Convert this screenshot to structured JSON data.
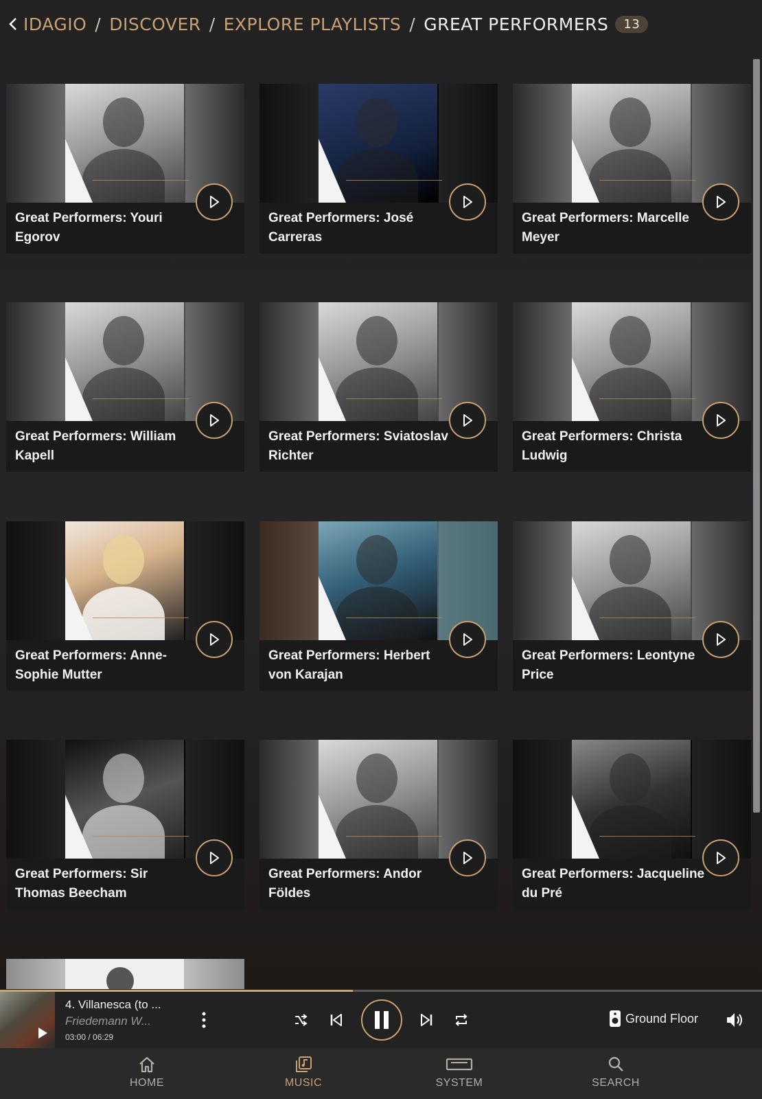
{
  "breadcrumb": {
    "items": [
      "IDAGIO",
      "DISCOVER",
      "EXPLORE PLAYLISTS"
    ],
    "current": "GREAT PERFORMERS",
    "count": "13",
    "separator": "/"
  },
  "playlists": [
    {
      "title": "Great Performers: Youri Egorov"
    },
    {
      "title": "Great Performers: José Carreras"
    },
    {
      "title": "Great Performers: Marcelle Meyer"
    },
    {
      "title": "Great Performers: William Kapell"
    },
    {
      "title": "Great Performers: Sviatoslav Richter"
    },
    {
      "title": "Great Performers: Christa Ludwig"
    },
    {
      "title": "Great Performers: Anne-Sophie Mutter"
    },
    {
      "title": "Great Performers: Herbert von Karajan"
    },
    {
      "title": "Great Performers: Leontyne Price"
    },
    {
      "title": "Great Performers: Sir Thomas Beecham"
    },
    {
      "title": "Great Performers: Andor Földes"
    },
    {
      "title": "Great Performers: Jacqueline du Pré"
    }
  ],
  "player": {
    "track_title": "4. Villanesca (to ...",
    "track_artist": "Friedemann W...",
    "time": "03:00 / 06:29",
    "progress": 0.463,
    "room": "Ground Floor"
  },
  "nav": {
    "home": "HOME",
    "music": "MUSIC",
    "system": "SYSTEM",
    "search": "SEARCH"
  },
  "colors": {
    "accent": "#c9a173",
    "background": "#232122"
  }
}
